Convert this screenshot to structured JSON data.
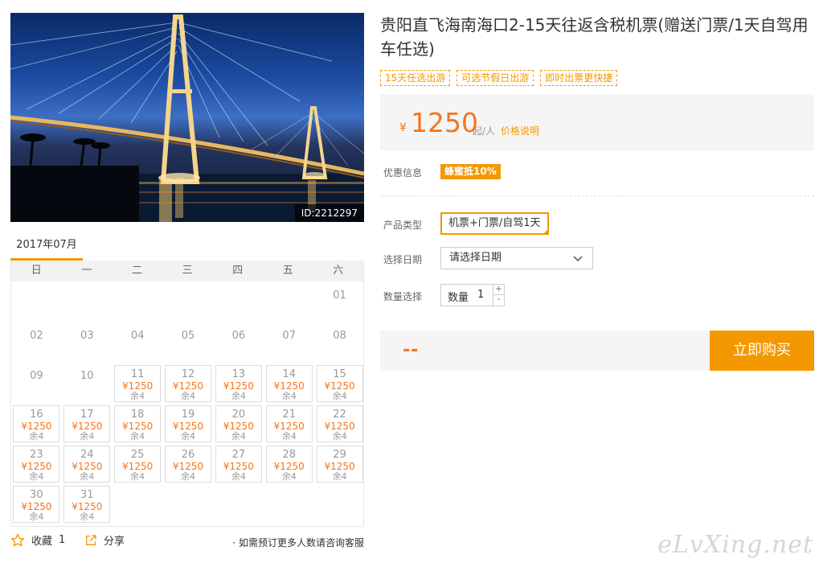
{
  "product": {
    "title": "贵阳直飞海南海口2-15天往返含税机票(赠送门票/1天自驾用车任选)",
    "tags": [
      "15天任选出游",
      "可选节假日出游",
      "即时出票更快捷"
    ],
    "image_id": "ID:2212297"
  },
  "price": {
    "currency": "¥",
    "amount": "1250",
    "unit": "起/人",
    "explain_link": "价格说明"
  },
  "promo": {
    "label": "优惠信息",
    "badge": "蜂蜜抵10%"
  },
  "product_type": {
    "label": "产品类型",
    "selected": "机票+门票/自驾1天"
  },
  "date_select": {
    "label": "选择日期",
    "placeholder": "请选择日期"
  },
  "quantity": {
    "label": "数量选择",
    "field_label": "数量",
    "value": "1",
    "plus": "+",
    "minus": "-"
  },
  "buy": {
    "total": "--",
    "button": "立即购买"
  },
  "calendar": {
    "month": "2017年07月",
    "weekdays": [
      "日",
      "一",
      "二",
      "三",
      "四",
      "五",
      "六"
    ],
    "price_text": "¥1250",
    "stock_text": "余4",
    "leading_blanks": 6,
    "days": [
      "01",
      "02",
      "03",
      "04",
      "05",
      "06",
      "07",
      "08",
      "09",
      "10",
      "11",
      "12",
      "13",
      "14",
      "15",
      "16",
      "17",
      "18",
      "19",
      "20",
      "21",
      "22",
      "23",
      "24",
      "25",
      "26",
      "27",
      "28",
      "29",
      "30",
      "31"
    ],
    "available_from": 11
  },
  "footer": {
    "favorite_label": "收藏",
    "favorite_count": "1",
    "share_label": "分享",
    "consult_text": "· 如需预订更多人数请咨询客服"
  },
  "watermark": "eLvXing.net",
  "colors": {
    "accent": "#f39800",
    "price": "#f5751a"
  }
}
